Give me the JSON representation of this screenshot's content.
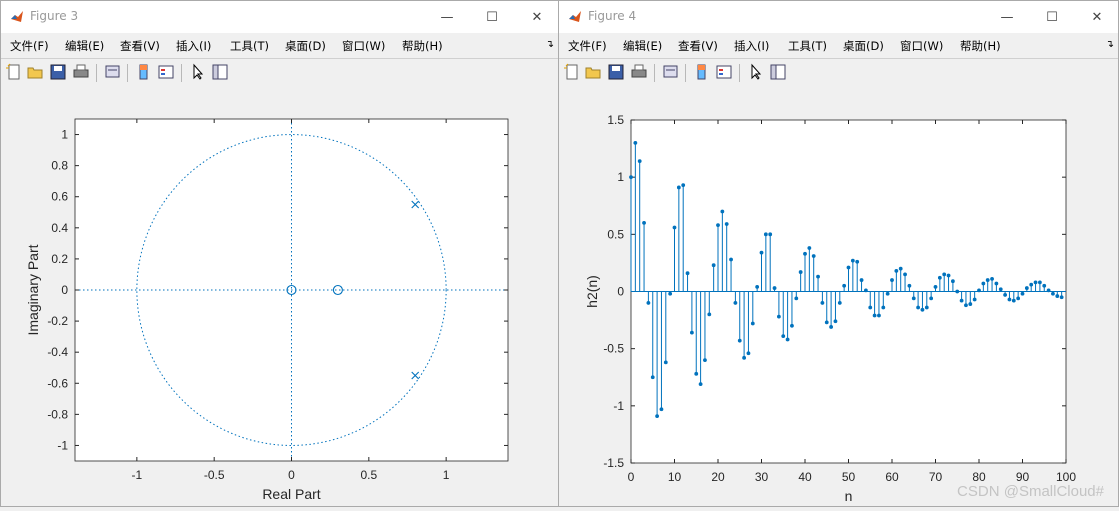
{
  "windows": {
    "fig3": {
      "title": "Figure 3"
    },
    "fig4": {
      "title": "Figure 4"
    }
  },
  "menu": [
    "文件(F)",
    "编辑(E)",
    "查看(V)",
    "插入(I)",
    "工具(T)",
    "桌面(D)",
    "窗口(W)",
    "帮助(H)"
  ],
  "toolbar_icons": [
    "new-figure-icon",
    "open-file-icon",
    "save-icon",
    "print-icon",
    "print-preview-icon",
    "colorbar-icon",
    "legend-icon",
    "edit-plot-arrow-icon",
    "property-inspector-icon"
  ],
  "window_controls": [
    "minimize-icon",
    "maximize-icon",
    "close-icon"
  ],
  "watermark": "CSDN @SmallCloud#",
  "chart_data": [
    {
      "type": "scatter",
      "title": "",
      "xlabel": "Real Part",
      "ylabel": "Imaginary Part",
      "xlim": [
        -1.4,
        1.4
      ],
      "ylim": [
        -1.1,
        1.1
      ],
      "xticks": [
        "-1",
        "-0.5",
        "0",
        "0.5",
        "1"
      ],
      "yticks": [
        "1",
        "0.8",
        "0.6",
        "0.4",
        "0.2",
        "0",
        "-0.2",
        "-0.4",
        "-0.6",
        "-0.8",
        "-1"
      ],
      "unit_circle": true,
      "zeros": [
        [
          0,
          0
        ],
        [
          0.3,
          0
        ]
      ],
      "poles": [
        [
          0.8,
          0.55
        ],
        [
          0.8,
          -0.55
        ]
      ],
      "color": "#0072bd"
    },
    {
      "type": "stem",
      "title": "",
      "xlabel": "n",
      "ylabel": "h2(n)",
      "xlim": [
        0,
        100
      ],
      "ylim": [
        -1.5,
        1.5
      ],
      "xticks": [
        "0",
        "10",
        "20",
        "30",
        "40",
        "50",
        "60",
        "70",
        "80",
        "90",
        "100"
      ],
      "yticks": [
        "1.5",
        "1",
        "0.5",
        "0",
        "-0.5",
        "-1",
        "-1.5"
      ],
      "x": [
        0,
        1,
        2,
        3,
        4,
        5,
        6,
        7,
        8,
        9,
        10,
        11,
        12,
        13,
        14,
        15,
        16,
        17,
        18,
        19,
        20,
        21,
        22,
        23,
        24,
        25,
        26,
        27,
        28,
        29,
        30,
        31,
        32,
        33,
        34,
        35,
        36,
        37,
        38,
        39,
        40,
        41,
        42,
        43,
        44,
        45,
        46,
        47,
        48,
        49,
        50,
        51,
        52,
        53,
        54,
        55,
        56,
        57,
        58,
        59,
        60,
        61,
        62,
        63,
        64,
        65,
        66,
        67,
        68,
        69,
        70,
        71,
        72,
        73,
        74,
        75,
        76,
        77,
        78,
        79,
        80,
        81,
        82,
        83,
        84,
        85,
        86,
        87,
        88,
        89,
        90,
        91,
        92,
        93,
        94,
        95,
        96,
        97,
        98,
        99
      ],
      "values": [
        1.0,
        1.3,
        1.14,
        0.6,
        -0.1,
        -0.75,
        -1.09,
        -1.03,
        -0.62,
        -0.02,
        0.56,
        0.91,
        0.93,
        0.16,
        -0.36,
        -0.72,
        -0.81,
        -0.6,
        -0.2,
        0.23,
        0.58,
        0.7,
        0.59,
        0.28,
        -0.1,
        -0.43,
        -0.58,
        -0.54,
        -0.28,
        0.04,
        0.34,
        0.5,
        0.5,
        0.03,
        -0.22,
        -0.39,
        -0.42,
        -0.3,
        -0.06,
        0.17,
        0.33,
        0.38,
        0.31,
        0.13,
        -0.1,
        -0.27,
        -0.31,
        -0.26,
        -0.1,
        0.05,
        0.21,
        0.27,
        0.26,
        0.1,
        0.01,
        -0.14,
        -0.21,
        -0.21,
        -0.14,
        -0.02,
        0.1,
        0.18,
        0.2,
        0.15,
        0.05,
        -0.06,
        -0.14,
        -0.16,
        -0.14,
        -0.06,
        0.04,
        0.12,
        0.15,
        0.14,
        0.09,
        0.0,
        -0.08,
        -0.12,
        -0.11,
        -0.07,
        0.01,
        0.07,
        0.1,
        0.11,
        0.07,
        0.02,
        -0.03,
        -0.07,
        -0.08,
        -0.06,
        -0.02,
        0.03,
        0.06,
        0.08,
        0.08,
        0.05,
        0.01,
        -0.02,
        -0.04,
        -0.05
      ],
      "color": "#0072bd"
    }
  ]
}
